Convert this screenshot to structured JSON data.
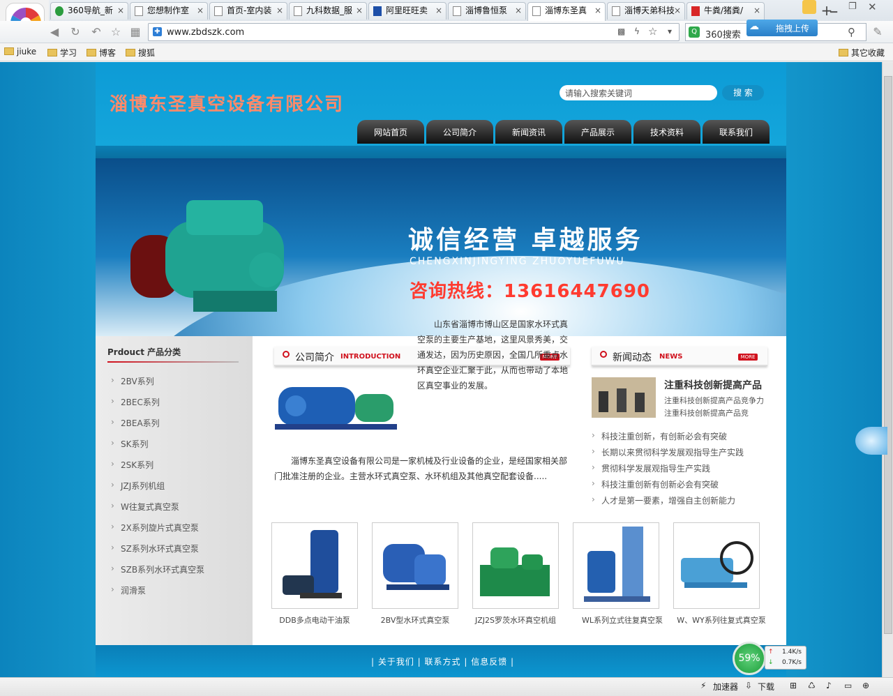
{
  "browser": {
    "tabs": [
      {
        "label": "360导航_新"
      },
      {
        "label": "您想制作室"
      },
      {
        "label": "首页-室内装"
      },
      {
        "label": "九科数据_服"
      },
      {
        "label": "阿里旺旺卖"
      },
      {
        "label": "淄博鲁恒泵"
      },
      {
        "label": "淄博东圣真"
      },
      {
        "label": "淄博天弟科技"
      },
      {
        "label": "牛粪/猪粪/"
      }
    ],
    "new_tab": "+",
    "url": "www.zbdszk.com",
    "search_label": "360搜索",
    "upload_label": "拖拽上传",
    "bookmarks": [
      "jiuke",
      "学习",
      "博客",
      "搜狐"
    ],
    "other_bookmarks": "其它收藏",
    "status": {
      "accelerator": "加速器",
      "download": "下载"
    },
    "speed": {
      "percent": "59%",
      "up": "1.4K/s",
      "down": "0.7K/s"
    }
  },
  "site": {
    "company": "淄博东圣真空设备有限公司",
    "search_placeholder": "请输入搜索关键词",
    "search_button": "搜 索",
    "nav": [
      "网站首页",
      "公司简介",
      "新闻资讯",
      "产品展示",
      "技术资料",
      "联系我们"
    ],
    "banner": {
      "slogan": "诚信经营  卓越服务",
      "pinyin": "CHENGXINJINGYING ZHUOYUEFUWU",
      "hotline": "咨询热线：13616447690"
    },
    "categories_title": "Prdouct 产品分类",
    "categories": [
      "2BV系列",
      "2BEC系列",
      "2BEA系列",
      "SK系列",
      "2SK系列",
      "JZJ系列机组",
      "W往复式真空泵",
      "2X系列旋片式真空泵",
      "SZ系列水环式真空泵",
      "SZB系列水环式真空泵",
      "润滑泵"
    ],
    "intro": {
      "title": "公司简介",
      "en": "INTRODUCTION",
      "more": "MORE",
      "p1": "山东省淄博市博山区是国家水环式真空泵的主要生产基地，这里风景秀美，交通发达，因为历史原因，全国几所重点水环真空企业汇聚于此，从而也带动了本地区真空事业的发展。",
      "p2": "淄博东圣真空设备有限公司是一家机械及行业设备的企业，是经国家相关部门批准注册的企业。主营水环式真空泵、水环机组及其他真空配套设备....."
    },
    "news": {
      "title": "新闻动态",
      "en": "NEWS",
      "more": "MORE",
      "feature_title": "注重科技创新提高产品",
      "feature_desc": "注重科技创新提高产品竞争力注重科技创新提高产品竞",
      "items": [
        "科技注重创新，有创新必会有突破",
        "长期以来贯彻科学发展观指导生产实践",
        "贯彻科学发展观指导生产实践",
        "科技注重创新有创新必会有突破",
        "人才是第一要素，增强自主创新能力"
      ]
    },
    "products": [
      {
        "name": "DDB多点电动干油泵"
      },
      {
        "name": "2BV型水环式真空泵"
      },
      {
        "name": "JZJ2S罗茨水环真空机组"
      },
      {
        "name": "WL系列立式往复真空泵"
      },
      {
        "name": "W、WY系列往复式真空泵"
      }
    ],
    "footer": "| 关于我们 | 联系方式 | 信息反馈 |"
  }
}
